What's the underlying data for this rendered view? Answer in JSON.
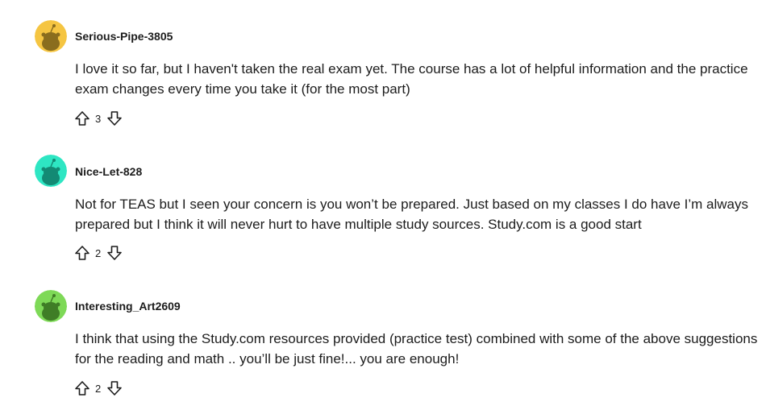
{
  "comments": [
    {
      "username": "Serious-Pipe-3805",
      "avatar_color": "#f5c542",
      "body": "I love it so far, but I haven't taken the real exam yet. The course has a lot of helpful information and the practice exam changes every time you take it (for the most part)",
      "votes": "3"
    },
    {
      "username": "Nice-Let-828",
      "avatar_color": "#2ee6c3",
      "body": "Not for TEAS but I seen your concern is you won’t be prepared. Just based on my classes I do have I’m always prepared but I think it will never hurt to have multiple study sources. Study.com is a good start",
      "votes": "2"
    },
    {
      "username": "Interesting_Art2609",
      "avatar_color": "#7ed957",
      "body": "I think that using the Study.com resources provided (practice test) combined with some of the above suggestions for the reading and math .. you’ll be just fine!... you are enough!",
      "votes": "2"
    }
  ],
  "icons": {
    "upvote": "upvote-arrow-icon",
    "downvote": "downvote-arrow-icon",
    "avatar": "snoo-avatar-icon"
  }
}
